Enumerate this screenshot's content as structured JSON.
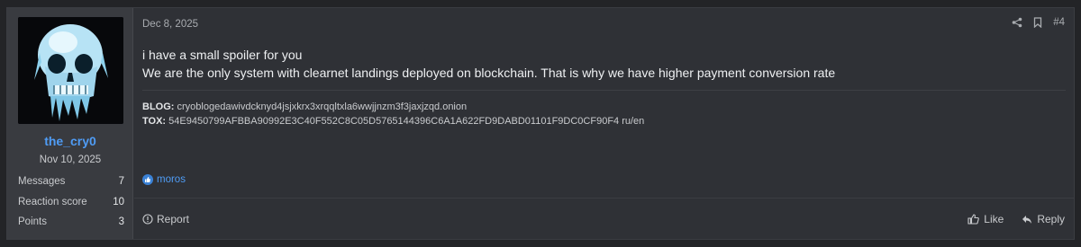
{
  "user": {
    "name": "the_cry0",
    "joined": "Nov 10, 2025",
    "stats": [
      {
        "label": "Messages",
        "value": "7"
      },
      {
        "label": "Reaction score",
        "value": "10"
      },
      {
        "label": "Points",
        "value": "3"
      }
    ]
  },
  "post": {
    "date": "Dec 8, 2025",
    "number": "#4",
    "lines": [
      "i have a small spoiler for you",
      "We are the only system with clearnet landings deployed on blockchain. That is why we have higher payment conversion rate"
    ],
    "signature": {
      "blog_label": "BLOG:",
      "blog_value": "cryoblogedawivdcknyd4jsjxkrx3xrqqltxla6wwjjnzm3f3jaxjzqd.onion",
      "tox_label": "TOX:",
      "tox_value": "54E9450799AFBBA90992E3C40F552C8C05D5765144396C6A1A622FD9DABD01101F9DC0CF90F4 ru/en"
    },
    "reaction_user": "moros"
  },
  "footer": {
    "report": "Report",
    "like": "Like",
    "reply": "Reply"
  },
  "icons": [
    "skull-avatar",
    "share-icon",
    "bookmark-icon",
    "like-reaction-icon",
    "report-icon",
    "thumbs-up-icon",
    "reply-icon"
  ]
}
